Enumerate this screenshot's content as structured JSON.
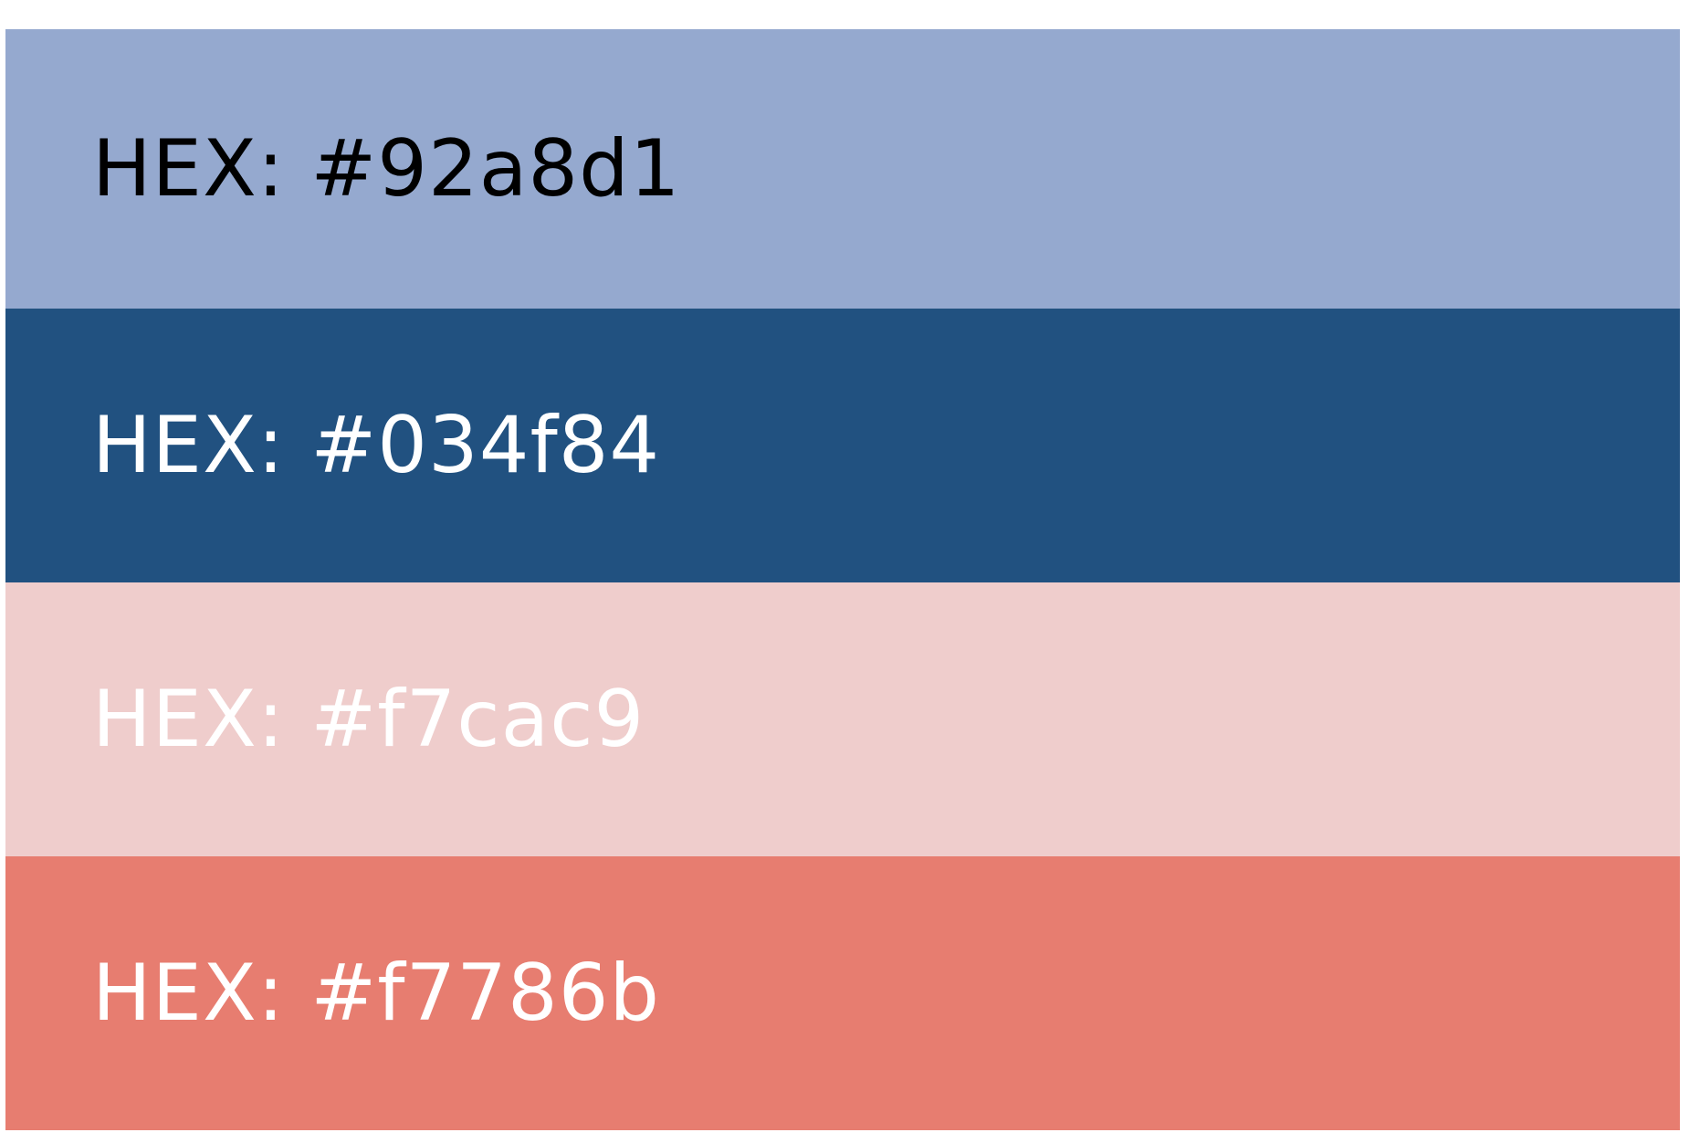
{
  "swatches": [
    {
      "label": "HEX: #92a8d1",
      "background": "#95a9cf",
      "text_color": "#000000"
    },
    {
      "label": "HEX: #034f84",
      "background": "#215180",
      "text_color": "#ffffff"
    },
    {
      "label": "HEX: #f7cac9",
      "background": "#efcdcc",
      "text_color": "#ffffff"
    },
    {
      "label": "HEX: #f7786b",
      "background": "#e77d70",
      "text_color": "#ffffff"
    }
  ]
}
